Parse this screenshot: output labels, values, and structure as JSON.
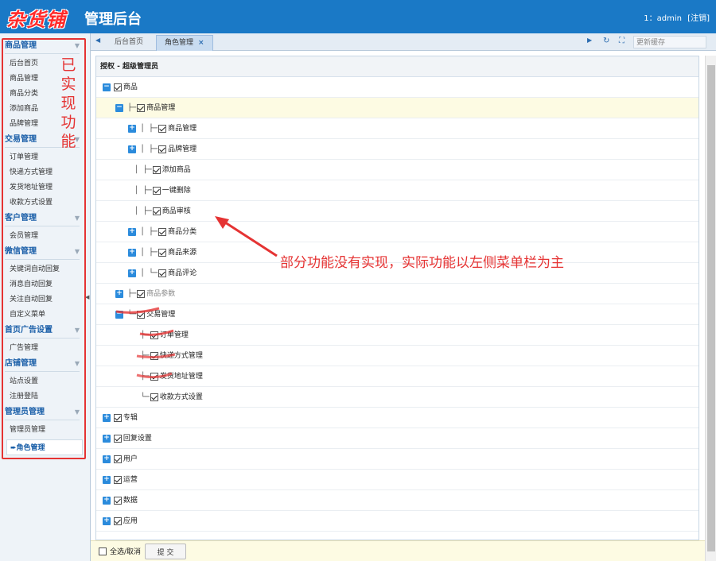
{
  "header": {
    "logo": "杂货铺",
    "title": "管理后台",
    "user": "1：admin",
    "logout": "[注销]"
  },
  "sidebar": {
    "groups": [
      {
        "title": "商品管理",
        "items": [
          "后台首页",
          "商品管理",
          "商品分类",
          "添加商品",
          "品牌管理"
        ]
      },
      {
        "title": "交易管理",
        "items": [
          "订单管理",
          "快递方式管理",
          "发货地址管理",
          "收款方式设置"
        ]
      },
      {
        "title": "客户管理",
        "items": [
          "会员管理"
        ]
      },
      {
        "title": "微信管理",
        "items": [
          "关键词自动回复",
          "消息自动回复",
          "关注自动回复",
          "自定义菜单"
        ]
      },
      {
        "title": "首页广告设置",
        "items": [
          "广告管理"
        ]
      },
      {
        "title": "店铺管理",
        "items": [
          "站点设置",
          "注册登陆"
        ]
      },
      {
        "title": "管理员管理",
        "items": [
          "管理员管理",
          "角色管理"
        ]
      }
    ],
    "active_item": "角色管理",
    "annotation": [
      "已",
      "实",
      "现",
      "功",
      "能"
    ]
  },
  "tabs": {
    "items": [
      "后台首页",
      "角色管理"
    ],
    "active": "角色管理",
    "close_glyph": "×",
    "refresh_label": "更新缓存"
  },
  "panel": {
    "title": "授权 - 超级管理员",
    "tree": [
      {
        "text": "商品"
      },
      {
        "text": "商品管理"
      },
      {
        "text": "商品管理"
      },
      {
        "text": "品牌管理"
      },
      {
        "text": "添加商品"
      },
      {
        "text": "一键删除"
      },
      {
        "text": "商品审核"
      },
      {
        "text": "商品分类"
      },
      {
        "text": "商品来源"
      },
      {
        "text": "商品评论"
      },
      {
        "text": "商品参数"
      },
      {
        "text": "交易管理"
      },
      {
        "text": "订单管理"
      },
      {
        "text": "快递方式管理"
      },
      {
        "text": "发货地址管理"
      },
      {
        "text": "收款方式设置"
      },
      {
        "text": "专辑"
      },
      {
        "text": "回复设置"
      },
      {
        "text": "用户"
      },
      {
        "text": "运营"
      },
      {
        "text": "数据"
      },
      {
        "text": "应用"
      }
    ]
  },
  "footer": {
    "select_all": "全选/取消",
    "submit": "提 交"
  },
  "annotation": {
    "text": "部分功能没有实现，实际功能以左侧菜单栏为主"
  },
  "colors": {
    "header": "#1a79c6",
    "accent_red": "#e53333",
    "tree_button": "#2b8bdc"
  }
}
